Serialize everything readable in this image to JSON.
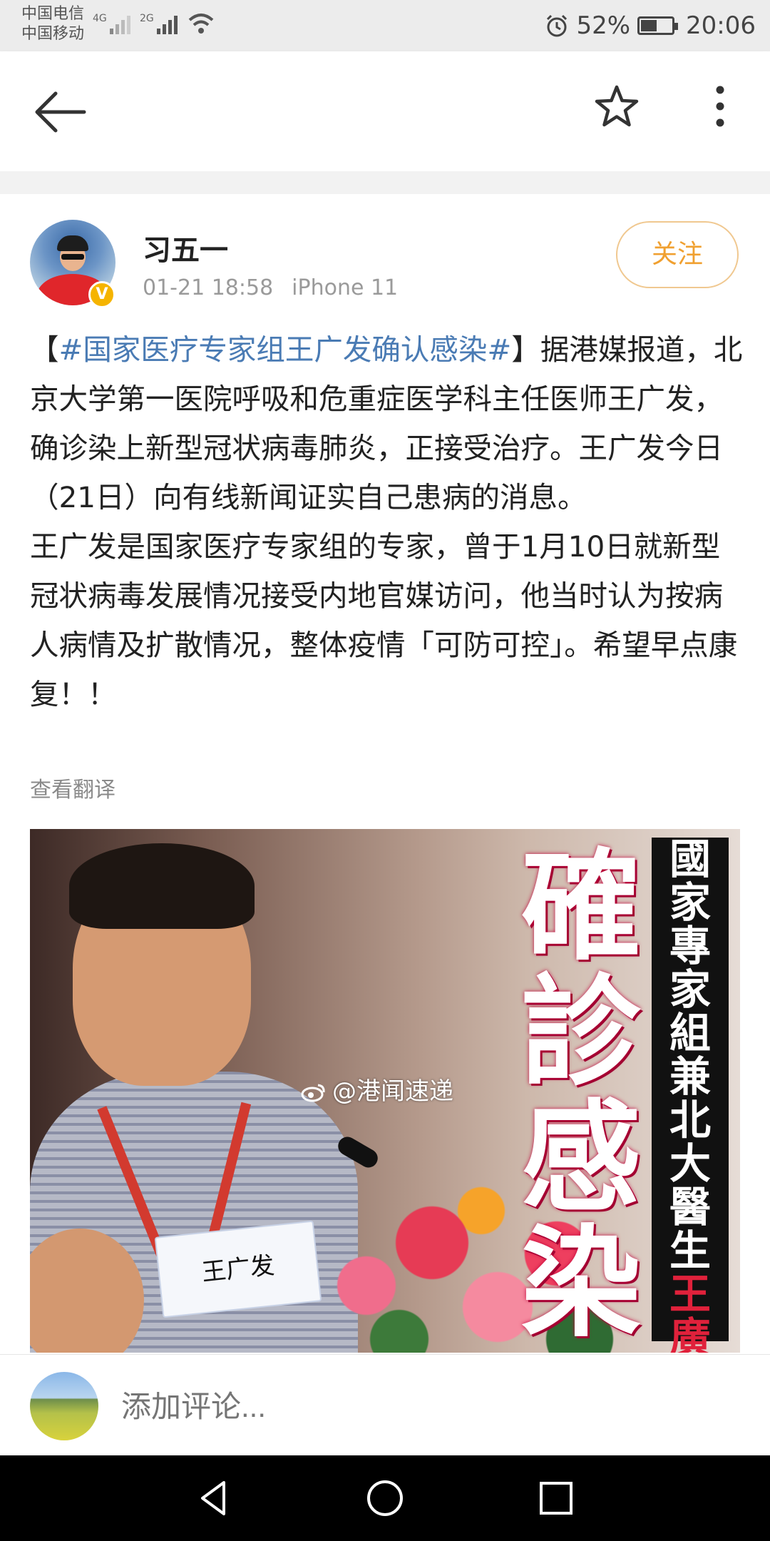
{
  "status_bar": {
    "carrier1": "中国电信",
    "carrier2": "中国移动",
    "net1": "4G",
    "net2": "2G",
    "battery": "52%",
    "battery_level": 0.52,
    "time": "20:06"
  },
  "top_bar": {
    "back_icon": "arrow-left-icon",
    "favorite_icon": "star-outline-icon",
    "more_icon": "more-vertical-icon"
  },
  "post": {
    "username": "习五一",
    "verified_badge": "V",
    "date": "01-21 18:58",
    "device": "iPhone 11",
    "follow_label": "关注",
    "body": {
      "bracket_open": "【",
      "topic": "#国家医疗专家组王广发确认感染#",
      "bracket_close": "】",
      "para1": "据港媒报道，北京大学第一医院呼吸和危重症医学科主任医师王广发，确诊染上新型冠状病毒肺炎，正接受治疗。王广发今日（21日）向有线新闻证实自己患病的消息。",
      "para2": "王广发是国家医疗专家组的专家，曾于1月10日就新型冠状病毒发展情况接受内地官媒访问，他当时认为按病人病情及扩散情况，整体疫情「可防可控」。希望早点康复！！"
    },
    "translate_label": "查看翻译",
    "image": {
      "headline_big": "確診感染",
      "headline_side_black": "國家專家組兼北大醫生",
      "headline_side_red": "王廣發",
      "watermark": "@港闻速递",
      "nameplate": "王广发"
    }
  },
  "comment_bar": {
    "placeholder": "添加评论..."
  },
  "nav_bar": {
    "back": "nav-back-icon",
    "home": "nav-home-icon",
    "recents": "nav-recents-icon"
  },
  "colors": {
    "topic": "#4a7bb4",
    "follow": "#f0a030",
    "verified": "#f5b400"
  }
}
